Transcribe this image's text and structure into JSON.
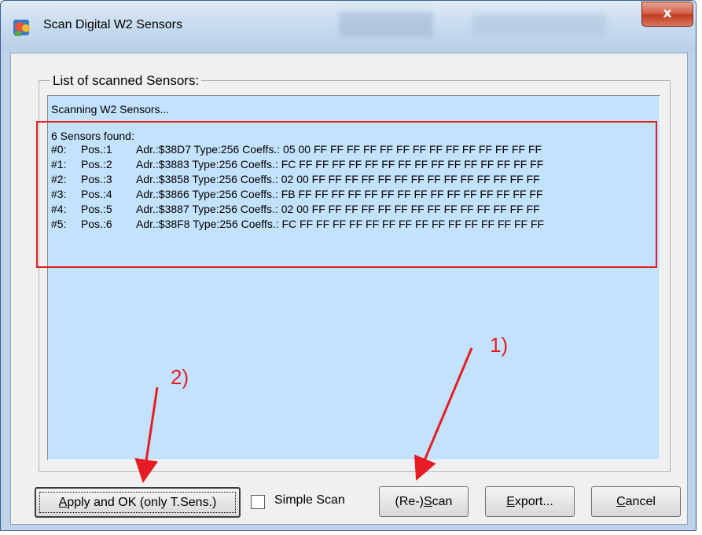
{
  "window": {
    "title": "Scan Digital W2 Sensors",
    "close_symbol": "x"
  },
  "group": {
    "legend": "List of scanned Sensors:"
  },
  "log": {
    "scanning": "Scanning W2 Sensors...",
    "found": "6 Sensors found:",
    "sensors": [
      {
        "index": "#0:",
        "pos": "Pos.:1",
        "info": "Adr.:$38D7 Type:256 Coeffs.: 05 00 FF FF FF FF FF FF FF FF FF FF FF FF FF FF"
      },
      {
        "index": "#1:",
        "pos": "Pos.:2",
        "info": "Adr.:$3883 Type:256 Coeffs.: FC FF FF FF FF FF FF FF FF FF FF FF FF FF FF FF"
      },
      {
        "index": "#2:",
        "pos": "Pos.:3",
        "info": "Adr.:$3858 Type:256 Coeffs.: 02 00 FF FF FF FF FF FF FF FF FF FF FF FF FF FF"
      },
      {
        "index": "#3:",
        "pos": "Pos.:4",
        "info": "Adr.:$3866 Type:256 Coeffs.: FB FF FF FF FF FF FF FF FF FF FF FF FF FF FF FF"
      },
      {
        "index": "#4:",
        "pos": "Pos.:5",
        "info": "Adr.:$3887 Type:256 Coeffs.: 02 00 FF FF FF FF FF FF FF FF FF FF FF FF FF FF"
      },
      {
        "index": "#5:",
        "pos": "Pos.:6",
        "info": "Adr.:$38F8 Type:256 Coeffs.: FC FF FF FF FF FF FF FF FF FF FF FF FF FF FF FF"
      }
    ]
  },
  "buttons": {
    "apply_ok": "Apply and OK (only T.Sens.)",
    "rescan": "(Re-)Scan",
    "export": "Export...",
    "cancel": "Cancel"
  },
  "simple_scan": {
    "label": "Simple Scan",
    "checked": false
  },
  "annotations": {
    "step1": "1)",
    "step2": "2)"
  },
  "colors": {
    "list_background": "#c3e2fd",
    "annotation_red": "#e51c23",
    "titlebar": "#c9dcf0",
    "close_button": "#c03c22"
  }
}
